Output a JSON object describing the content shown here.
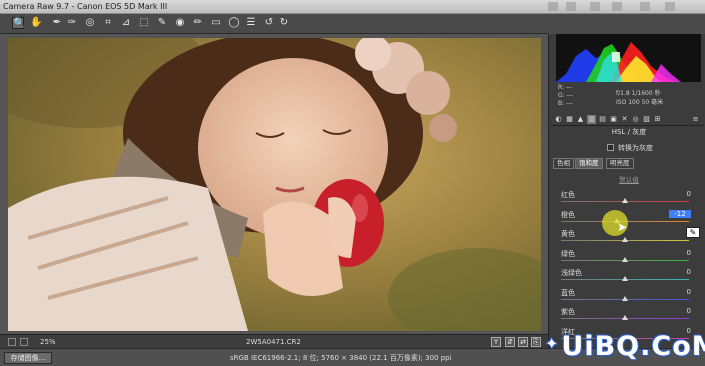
{
  "window": {
    "title": "Camera Raw 9.7 - Canon EOS 5D Mark III"
  },
  "toolbar": {
    "tools": [
      {
        "icon": "zoom-icon",
        "glyph": "🔍",
        "active": true
      },
      {
        "icon": "hand-icon",
        "glyph": "✋"
      },
      {
        "icon": "white-balance-icon",
        "glyph": "✒"
      },
      {
        "icon": "color-sampler-icon",
        "glyph": "✑"
      },
      {
        "icon": "targeted-adjustment-icon",
        "glyph": "◎"
      },
      {
        "icon": "crop-icon",
        "glyph": "⌗"
      },
      {
        "icon": "straighten-icon",
        "glyph": "⊿"
      },
      {
        "icon": "transform-icon",
        "glyph": "⬚"
      },
      {
        "icon": "spot-removal-icon",
        "glyph": "✎"
      },
      {
        "icon": "red-eye-icon",
        "glyph": "◉"
      },
      {
        "icon": "adjustment-brush-icon",
        "glyph": "✏"
      },
      {
        "icon": "graduated-filter-icon",
        "glyph": "▭"
      },
      {
        "icon": "radial-filter-icon",
        "glyph": "◯"
      },
      {
        "icon": "preferences-icon",
        "glyph": "☰"
      },
      {
        "icon": "rotate-ccw-icon",
        "glyph": "↺"
      },
      {
        "icon": "rotate-cw-icon",
        "glyph": "↻"
      }
    ]
  },
  "status": {
    "zoom": "25%",
    "filename": "2W5A0471.CR2"
  },
  "footer": {
    "save_label": "存储图像...",
    "info": "sRGB IEC61966-2.1; 8 位; 5760 × 3840 (22.1 百万像素); 300 ppi"
  },
  "readout": {
    "r": "R:  ---",
    "g": "G:  ---",
    "b": "B:  ---",
    "line1": "f/1.8   1/1600 秒",
    "line2": "ISO 100   50 毫米"
  },
  "panel": {
    "section_title": "HSL / 灰度",
    "grayscale_label": "转换为灰度",
    "subtabs": [
      "色相",
      "饱和度",
      "明亮度"
    ],
    "active_subtab": 1,
    "default_label": "默认值",
    "rows": [
      {
        "label": "红色",
        "value": "0",
        "track": "#d23a3a",
        "thumb_pct": 50
      },
      {
        "label": "橙色",
        "value": "-12",
        "track": "#e28a2a",
        "thumb_pct": 44,
        "editing": true
      },
      {
        "label": "黄色",
        "value": "0",
        "track": "#d6c83a",
        "thumb_pct": 50
      },
      {
        "label": "绿色",
        "value": "0",
        "track": "#3ab43a",
        "thumb_pct": 50
      },
      {
        "label": "浅绿色",
        "value": "0",
        "track": "#3ab4b4",
        "thumb_pct": 50
      },
      {
        "label": "蓝色",
        "value": "0",
        "track": "#3a5ad6",
        "thumb_pct": 50
      },
      {
        "label": "紫色",
        "value": "0",
        "track": "#8a3ad6",
        "thumb_pct": 50
      },
      {
        "label": "洋红",
        "value": "0",
        "track": "#d63ab4",
        "thumb_pct": 50
      }
    ]
  },
  "watermark": {
    "logo_text": "UiBQ.CoM"
  }
}
